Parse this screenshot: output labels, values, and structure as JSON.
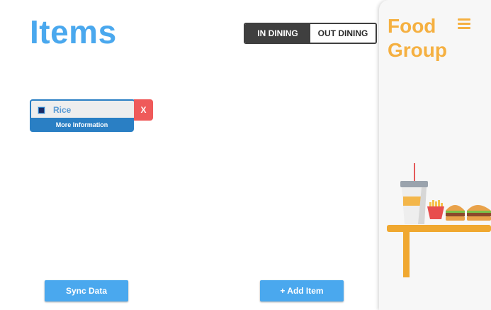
{
  "header": {
    "title": "Items"
  },
  "dining_toggle": {
    "in_label": "IN DINING",
    "out_label": "OUT DINING",
    "active": "in"
  },
  "items": [
    {
      "name": "Rice",
      "more_label": "More Information",
      "delete_label": "X"
    }
  ],
  "actions": {
    "sync_label": "Sync Data",
    "add_label": "+ Add Item"
  },
  "sidebar": {
    "brand_line1": "Food",
    "brand_line2": "Group"
  },
  "colors": {
    "accent_blue": "#4aa8ee",
    "brand_orange": "#f5b041",
    "delete_red": "#ef5a5a",
    "toggle_dark": "#3f3f3f"
  },
  "icons": [
    "menu-icon",
    "checkbox-icon",
    "food-table-illustration"
  ]
}
